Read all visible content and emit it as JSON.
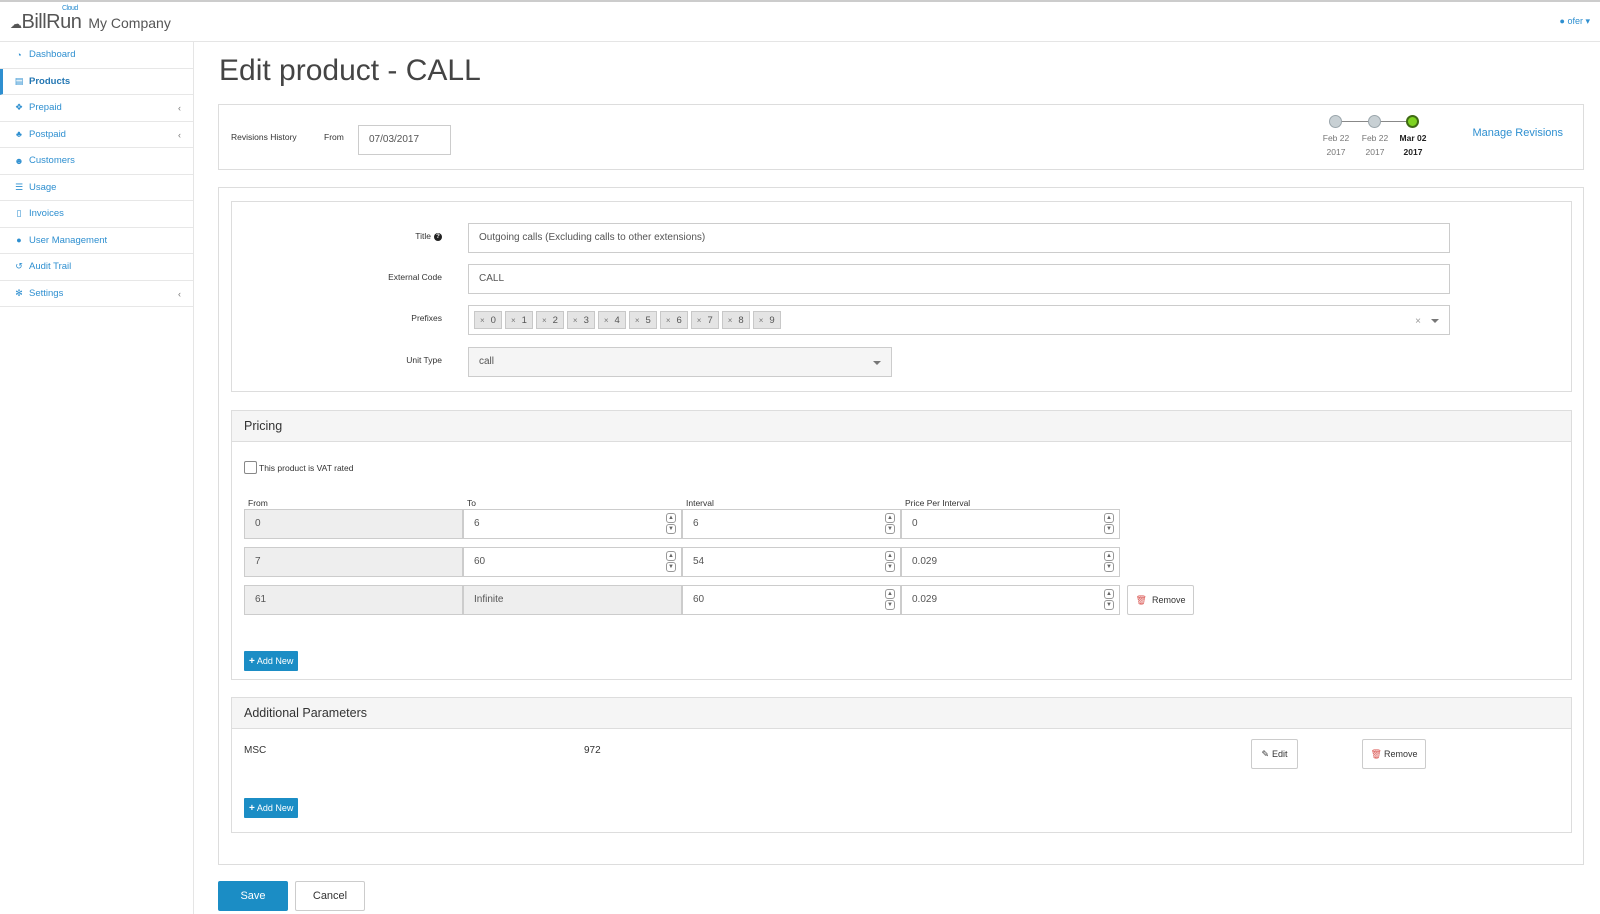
{
  "app": {
    "brand": "BillRun",
    "brand_sup": "Cloud",
    "company": "My Company",
    "user": "ofer"
  },
  "sidebar": {
    "items": [
      {
        "label": "Dashboard",
        "icon": "dashboard-icon"
      },
      {
        "label": "Products",
        "icon": "book-icon"
      },
      {
        "label": "Prepaid",
        "icon": "cubes-icon"
      },
      {
        "label": "Postpaid",
        "icon": "sitemap-icon"
      },
      {
        "label": "Customers",
        "icon": "users-icon"
      },
      {
        "label": "Usage",
        "icon": "list-icon"
      },
      {
        "label": "Invoices",
        "icon": "file-icon"
      },
      {
        "label": "User Management",
        "icon": "user-icon"
      },
      {
        "label": "Audit Trail",
        "icon": "history-icon"
      },
      {
        "label": "Settings",
        "icon": "gear-icon"
      }
    ]
  },
  "page": {
    "title": "Edit product - CALL"
  },
  "revisions": {
    "label": "Revisions History",
    "from_label": "From",
    "from_value": "07/03/2017",
    "manage": "Manage Revisions",
    "timeline": [
      {
        "month": "Feb 22",
        "year": "2017",
        "active": false
      },
      {
        "month": "Feb 22",
        "year": "2017",
        "active": false
      },
      {
        "month": "Mar 02",
        "year": "2017",
        "active": true
      }
    ]
  },
  "form": {
    "title_label": "Title",
    "title_value": "Outgoing calls (Excluding calls to other extensions)",
    "external_code_label": "External Code",
    "external_code_value": "CALL",
    "prefixes_label": "Prefixes",
    "prefixes": [
      "0",
      "1",
      "2",
      "3",
      "4",
      "5",
      "6",
      "7",
      "8",
      "9"
    ],
    "unit_type_label": "Unit Type",
    "unit_type_value": "call"
  },
  "pricing": {
    "heading": "Pricing",
    "vat_label": "This product is VAT rated",
    "columns": [
      "From",
      "To",
      "Interval",
      "Price Per Interval"
    ],
    "rows": [
      {
        "from": "0",
        "to": "6",
        "interval": "6",
        "price": "0"
      },
      {
        "from": "7",
        "to": "60",
        "interval": "54",
        "price": "0.029"
      },
      {
        "from": "61",
        "to": "Infinite",
        "interval": "60",
        "price": "0.029"
      }
    ],
    "remove_label": "Remove",
    "add_label": "Add New"
  },
  "params": {
    "heading": "Additional Parameters",
    "key": "MSC",
    "value": "972",
    "edit_label": "Edit",
    "remove_label": "Remove",
    "add_label": "Add New"
  },
  "actions": {
    "save": "Save",
    "cancel": "Cancel"
  }
}
